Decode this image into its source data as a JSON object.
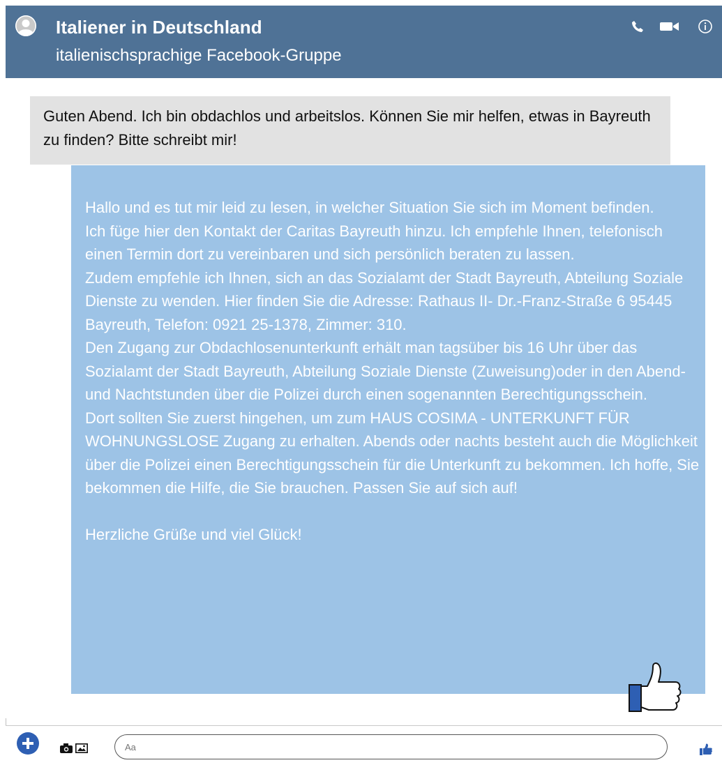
{
  "header": {
    "title": "Italiener in Deutschland",
    "subtitle": "italienischsprachige Facebook-Gruppe",
    "icons": [
      "avatar-icon",
      "phone-icon",
      "video-icon",
      "info-icon"
    ]
  },
  "messages": {
    "incoming": {
      "text": "Guten Abend. Ich bin obdachlos und arbeitslos. Können Sie mir helfen, etwas in Bayreuth zu finden? Bitte schreibt mir!"
    },
    "outgoing": {
      "paragraphs": [
        "Hallo und es tut mir leid zu lesen, in welcher Situation Sie sich im Moment befinden.",
        "Ich füge hier den Kontakt der Caritas Bayreuth hinzu. Ich empfehle Ihnen, telefonisch einen Termin dort zu vereinbaren und sich persönlich beraten zu lassen.",
        "Zudem empfehle ich Ihnen, sich an das Sozialamt der Stadt Bayreuth, Abteilung Soziale Dienste zu wenden. Hier finden Sie die Adresse: Rathaus II- Dr.-Franz-Straße 6 95445 Bayreuth, Telefon: 0921 25-1378, Zimmer: 310.",
        "Den Zugang zur Obdachlosenunterkunft erhält man tagsüber bis 16 Uhr über das Sozialamt der Stadt Bayreuth, Abteilung Soziale Dienste (Zuweisung)oder in den Abend- und Nachtstunden über die Polizei durch einen sogenannten Berechtigungsschein.",
        "Dort sollten Sie zuerst hingehen, um zum HAUS COSIMA - UNTERKUNFT FÜR WOHNUNGSLOSE Zugang zu erhalten. Abends oder nachts besteht auch die Möglichkeit über die Polizei einen Berechtigungsschein für die Unterkunft zu bekommen. Ich hoffe, Sie bekommen die Hilfe, die Sie brauchen. Passen Sie auf sich auf!"
      ],
      "closing": "Herzliche Grüße und viel Glück!",
      "reaction": "thumbs-up-icon"
    }
  },
  "composer": {
    "placeholder": "Aa",
    "icons": [
      "plus-icon",
      "camera-icon",
      "image-icon",
      "thumbs-up-icon"
    ]
  },
  "colors": {
    "header": "#4f7296",
    "incoming_bubble": "#e2e2e2",
    "outgoing_bubble": "#9dc3e6",
    "like_blue": "#2e5fb3"
  }
}
